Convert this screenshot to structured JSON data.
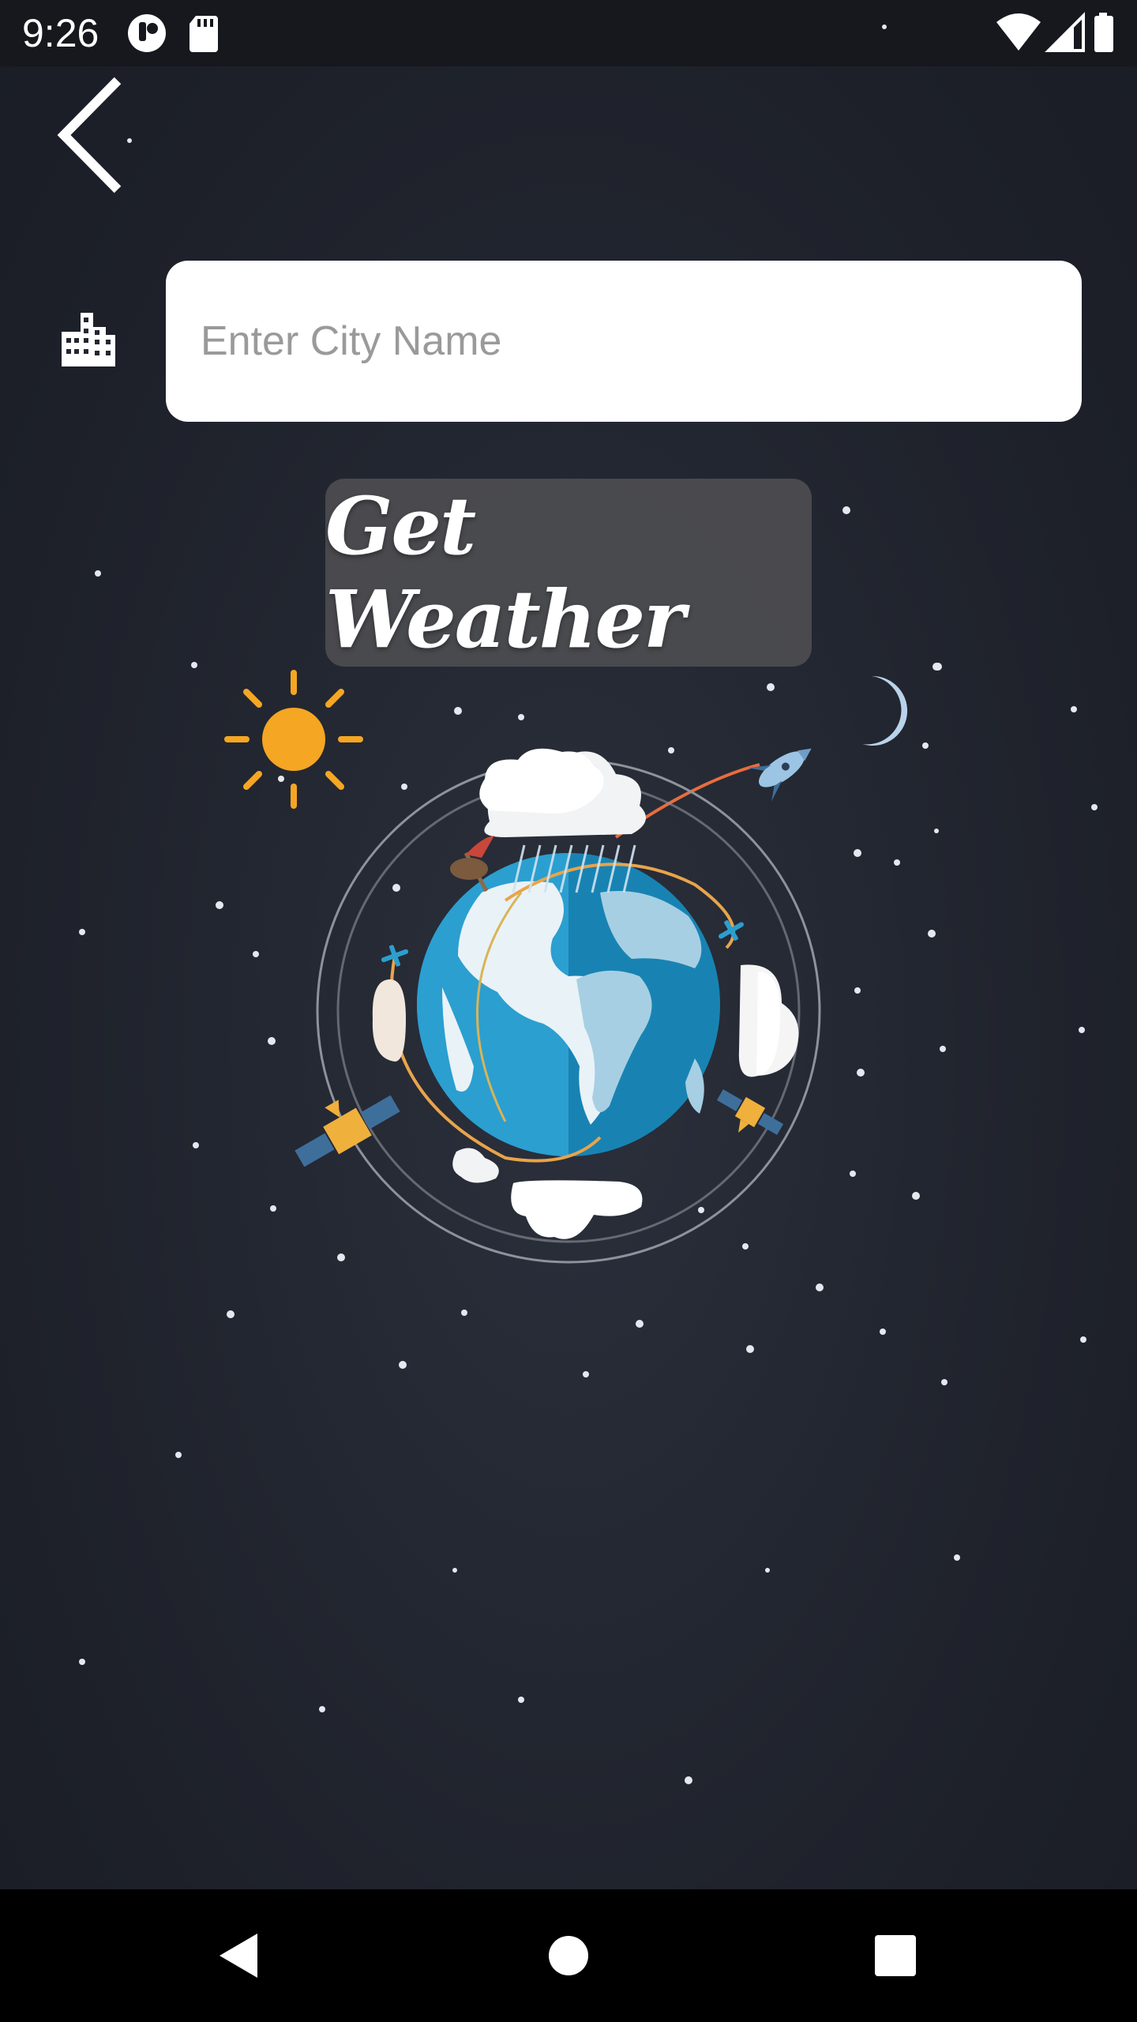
{
  "status_bar": {
    "time": "9:26",
    "left_icons": [
      "pocket-icon",
      "sd-card-icon"
    ],
    "right_icons": [
      "wifi-icon",
      "signal-icon",
      "battery-icon"
    ]
  },
  "header": {
    "back_icon": "chevron-left-icon"
  },
  "search": {
    "city_icon": "city-buildings-icon",
    "placeholder": "Enter City Name",
    "value": ""
  },
  "actions": {
    "get_weather_label": "Get Weather"
  },
  "illustration": {
    "elements": [
      "earth-globe",
      "sun-icon",
      "moon-icon",
      "rocket-icon",
      "clouds",
      "satellites",
      "airplanes",
      "stars"
    ]
  },
  "nav_bar": {
    "back": "nav-back-icon",
    "home": "nav-home-icon",
    "recents": "nav-recents-icon"
  },
  "colors": {
    "background": "#22262f",
    "sun": "#f5a623",
    "moon": "#b9d3ea",
    "ocean": "#1e8fc0",
    "button_bg": "#4f4f53"
  }
}
